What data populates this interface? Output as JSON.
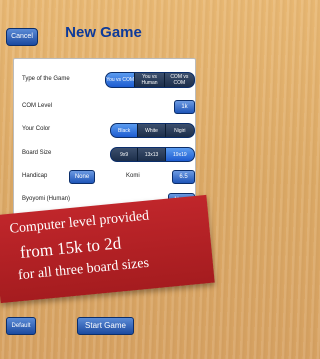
{
  "nav": {
    "cancel_label": "Cancel",
    "title": "New Game"
  },
  "settings": {
    "type_label": "Type of the Game",
    "type_options": [
      "You vs COM",
      "You vs Human",
      "COM vs COM"
    ],
    "com_level_label": "COM Level",
    "com_level_value": "1k",
    "color_label": "Your Color",
    "color_options": [
      "Black",
      "White",
      "Nigiri"
    ],
    "board_label": "Board Size",
    "board_options": [
      "9x9",
      "13x13",
      "19x19"
    ],
    "handicap_label": "Handicap",
    "handicap_value": "None",
    "komi_label": "Komi",
    "komi_value": "6.5",
    "byoyomi_label": "Byoyomi (Human)",
    "byoyomi_value": "None"
  },
  "banner": {
    "line1": "Computer level provided",
    "line2": "from 15k to 2d",
    "line3": "for all three board sizes"
  },
  "footer": {
    "default_label": "Default",
    "start_label": "Start Game"
  },
  "colors": {
    "accent": "#1d5cd0",
    "banner": "#b32024",
    "title": "#0d3a9a"
  }
}
